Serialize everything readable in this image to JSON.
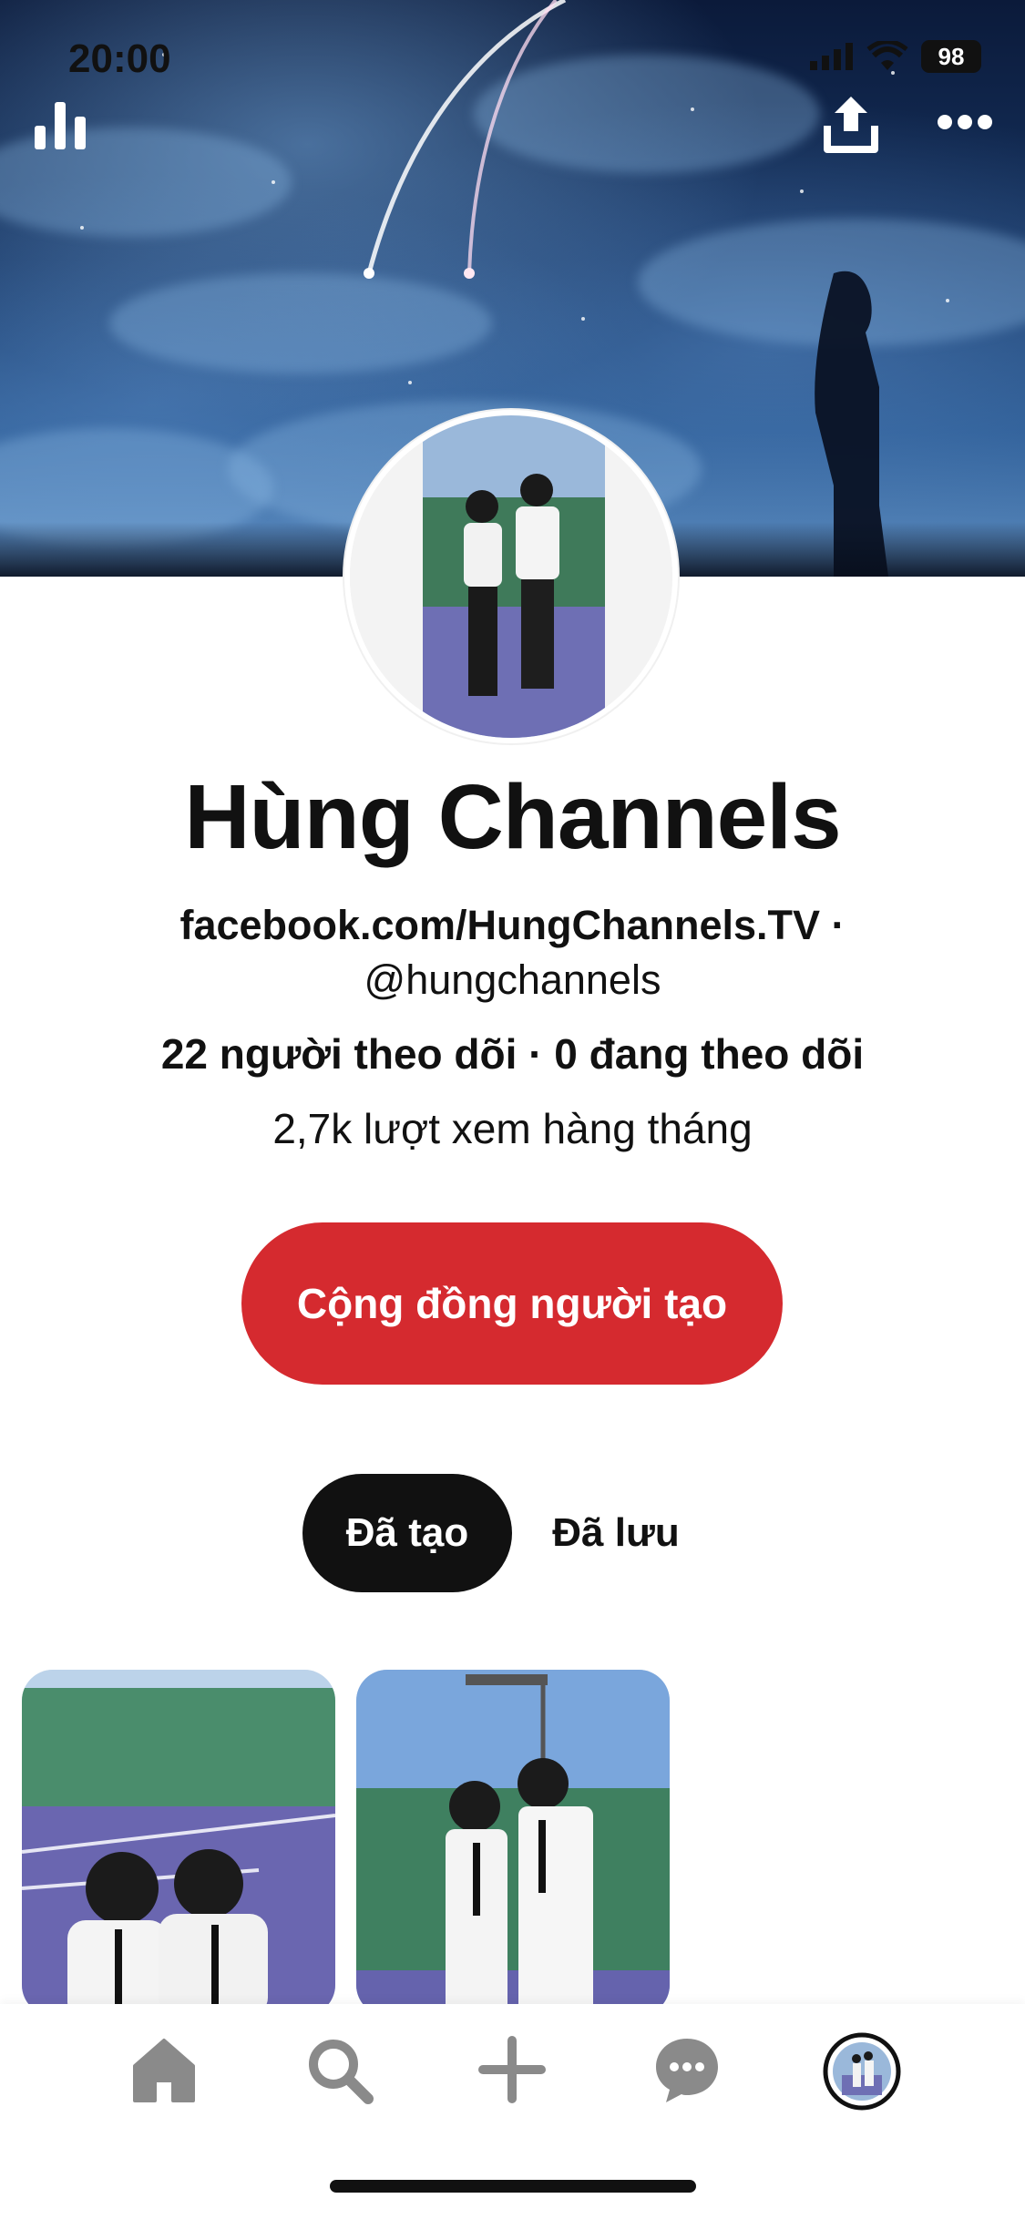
{
  "status_bar": {
    "time": "20:00",
    "battery": "98"
  },
  "top_bar": {
    "stats_icon": "bar-chart-icon",
    "share_icon": "share-upload-icon",
    "more_icon": "more-dots-icon"
  },
  "profile": {
    "name": "Hùng Channels",
    "link": "facebook.com/HungChannels.TV ·",
    "handle": "@hungchannels",
    "follow_stats": "22 người theo dõi · 0 đang theo dõi",
    "monthly_views": "2,7k lượt xem hàng tháng"
  },
  "actions": {
    "creator_community_label": "Cộng đồng người tạo"
  },
  "tabs": [
    {
      "label": "Đã tạo",
      "active": true
    },
    {
      "label": "Đã lưu",
      "active": false
    }
  ],
  "bottom_nav": [
    "home-icon",
    "search-icon",
    "plus-icon",
    "chat-icon",
    "profile-avatar"
  ],
  "colors": {
    "accent": "#d52a2f",
    "active_tab": "#111111",
    "nav_icon": "#8a8a8a"
  }
}
